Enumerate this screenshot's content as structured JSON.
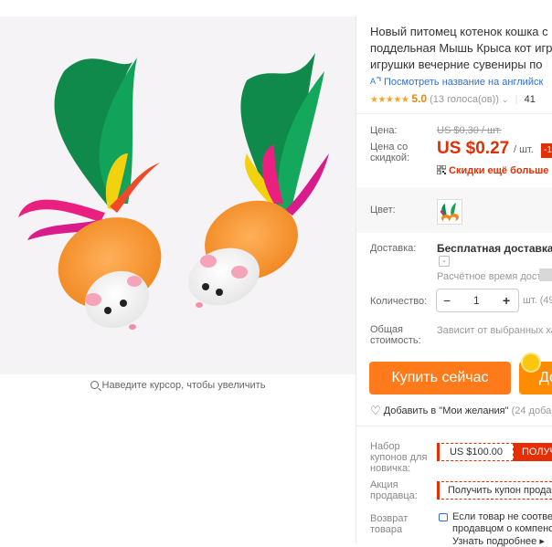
{
  "gallery": {
    "zoom_hint": "Наведите курсор, чтобы увеличить"
  },
  "product": {
    "title_lines": [
      "Новый питомец котенок кошка с",
      "поддельная Мышь Крыса кот игр",
      "игрушки вечерние сувениры по"
    ],
    "translate_link": "Посмотреть название на английск",
    "rating": {
      "stars": "★★★★★",
      "score": "5.0",
      "votes": "(13 голоса(ов))",
      "orders": "41"
    }
  },
  "price": {
    "label": "Цена:",
    "original": "US $0,30 / шт.",
    "sale_label_line1": "Цена со",
    "sale_label_line2": "скидкой:",
    "sale": "US $0.27",
    "unit": "/ шт.",
    "discount_badge": "-1",
    "promo": "Скидки ещё больше в"
  },
  "color": {
    "label": "Цвет:"
  },
  "shipping": {
    "label": "Доставка:",
    "value": "Бесплатная доставка в",
    "estimate": "Расчётное время доставк"
  },
  "quantity": {
    "label": "Количество:",
    "minus": "−",
    "value": "1",
    "plus": "+",
    "unit": "шт. (49"
  },
  "total": {
    "label_line1": "Общая",
    "label_line2": "стоимость:",
    "value": "Зависит от выбранных ха"
  },
  "actions": {
    "buy_now": "Купить сейчас",
    "add_to_cart": "До",
    "wishlist": "Добавить в \"Мои желания\"",
    "wishlist_count": "(24 доба"
  },
  "coupons": {
    "newbie_label_lines": [
      "Набор",
      "купонов для",
      "новичка:"
    ],
    "newbie_amount": "US $100.00",
    "newbie_button": "ПОЛУЧ",
    "seller_label_lines": [
      "Акция",
      "продавца:"
    ],
    "seller_button": "Получить купон прода"
  },
  "returns": {
    "label_lines": [
      "Возврат",
      "товара"
    ],
    "text_line1": "Если товар не соответ",
    "text_line2": "продавцом о компенс",
    "text_line3": "Узнать подробнее ▸"
  },
  "colors": {
    "accent_red": "#e62e04",
    "buy_orange": "#ff7a1a",
    "cart_orange": "#ff8c00",
    "link_blue": "#2f6fd7",
    "star_yellow": "#f5a623"
  }
}
